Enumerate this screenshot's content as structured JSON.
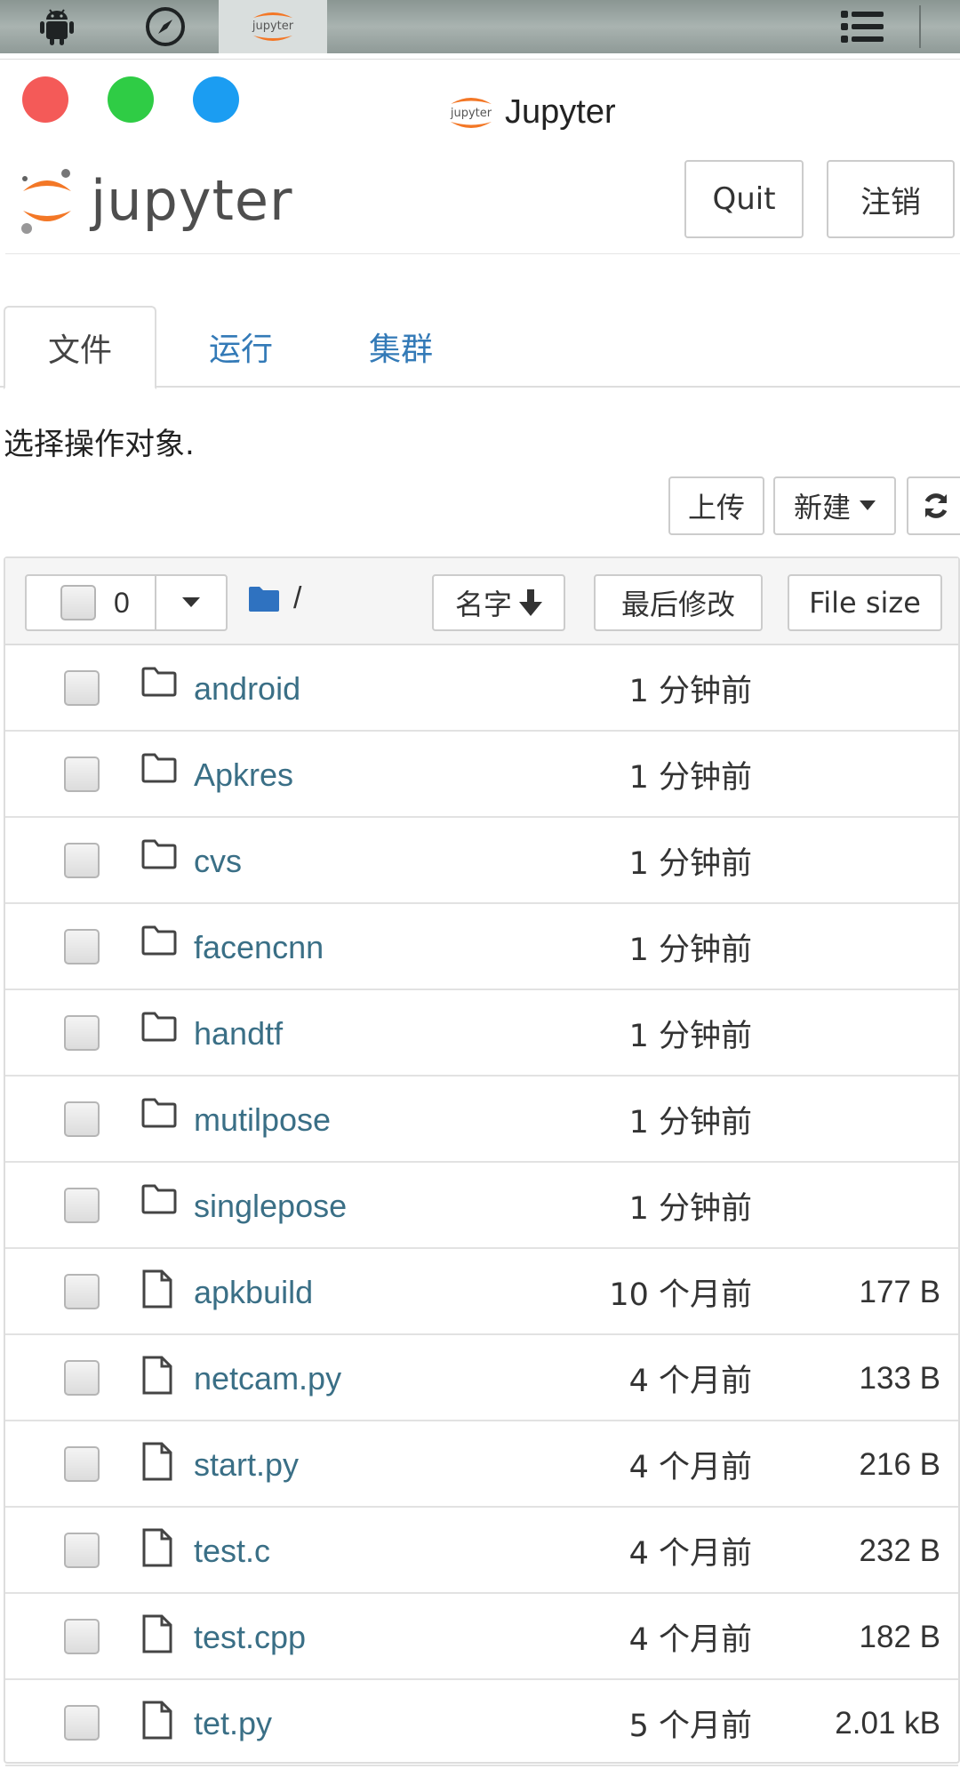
{
  "window": {
    "title": "Jupyter"
  },
  "header": {
    "logo_text": "jupyter",
    "quit_label": "Quit",
    "logout_label": "注销"
  },
  "tabs": [
    {
      "label": "文件",
      "active": true
    },
    {
      "label": "运行",
      "active": false
    },
    {
      "label": "集群",
      "active": false
    }
  ],
  "hint": "选择操作对象.",
  "toolbar": {
    "upload_label": "上传",
    "new_label": "新建"
  },
  "list_header": {
    "selected_count": "0",
    "path": "/",
    "sort_name": "名字",
    "sort_modified": "最后修改",
    "sort_size": "File size"
  },
  "files": [
    {
      "name": "android",
      "type": "folder",
      "modified": "1 分钟前",
      "size": ""
    },
    {
      "name": "Apkres",
      "type": "folder",
      "modified": "1 分钟前",
      "size": ""
    },
    {
      "name": "cvs",
      "type": "folder",
      "modified": "1 分钟前",
      "size": ""
    },
    {
      "name": "facencnn",
      "type": "folder",
      "modified": "1 分钟前",
      "size": ""
    },
    {
      "name": "handtf",
      "type": "folder",
      "modified": "1 分钟前",
      "size": ""
    },
    {
      "name": "mutilpose",
      "type": "folder",
      "modified": "1 分钟前",
      "size": ""
    },
    {
      "name": "singlepose",
      "type": "folder",
      "modified": "1 分钟前",
      "size": ""
    },
    {
      "name": "apkbuild",
      "type": "file",
      "modified": "10 个月前",
      "size": "177 B"
    },
    {
      "name": "netcam.py",
      "type": "file",
      "modified": "4 个月前",
      "size": "133 B"
    },
    {
      "name": "start.py",
      "type": "file",
      "modified": "4 个月前",
      "size": "216 B"
    },
    {
      "name": "test.c",
      "type": "file",
      "modified": "4 个月前",
      "size": "232 B"
    },
    {
      "name": "test.cpp",
      "type": "file",
      "modified": "4 个月前",
      "size": "182 B"
    },
    {
      "name": "tet.py",
      "type": "file",
      "modified": "5 个月前",
      "size": "2.01 kB"
    }
  ],
  "colors": {
    "link": "#3a6f86",
    "jupyter_orange": "#f37726",
    "folder_icon_blue": "#2f72c0"
  }
}
